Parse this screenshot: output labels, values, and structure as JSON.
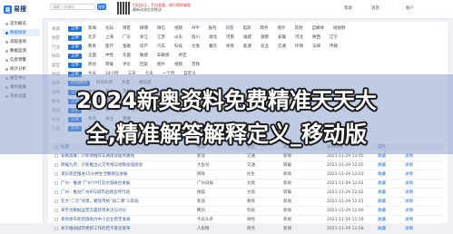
{
  "app": {
    "logo_text": "易搜",
    "logo_mark": "易"
  },
  "sidebar": {
    "items": [
      {
        "label": "首页概览",
        "active": false
      },
      {
        "label": "数据搜索",
        "active": true
      },
      {
        "label": "高级查询",
        "active": false
      },
      {
        "label": "数据监测",
        "active": false
      },
      {
        "label": "信息预警",
        "active": false
      },
      {
        "label": "统计分析",
        "active": false
      },
      {
        "label": "报告中心",
        "active": false
      },
      {
        "label": "素材收藏",
        "active": false
      },
      {
        "label": "系统设置",
        "active": false
      }
    ]
  },
  "topbar": {
    "search_placeholder": "请输入关键词",
    "search_button": "搜索",
    "advanced_button": "高级检索",
    "promo_line1": "扫码关注，手机查看，随时随地掌握",
    "promo_line2": "最新动态信息推送",
    "right_links": [
      "帮助",
      "消息",
      "账户"
    ]
  },
  "filters": [
    {
      "label": "来源",
      "tags": [
        "全部",
        "新闻",
        "论坛",
        "博客",
        "微博",
        "微信",
        "视频",
        "APP",
        "报刊",
        "问答",
        "电商",
        "政务",
        "境外",
        "其他",
        "自媒体",
        "短视频"
      ]
    },
    {
      "label": "地区",
      "tags": [
        "全部",
        "北京",
        "上海",
        "广东",
        "浙江",
        "江苏",
        "山东",
        "四川",
        "湖北",
        "河南",
        "福建",
        "湖南",
        "安徽",
        "河北",
        "陕西",
        "辽宁"
      ]
    },
    {
      "label": "行业",
      "tags": [
        "全部",
        "教育",
        "医疗",
        "金融",
        "房产",
        "汽车",
        "科技",
        "文旅",
        "餐饮",
        "体育",
        "能源",
        "农业",
        "交通",
        "环保",
        "法律",
        "传媒"
      ]
    },
    {
      "label": "倾向",
      "tags": [
        "全部",
        "正面",
        "中性",
        "负面",
        "敏感",
        "非敏感",
        "待定"
      ]
    },
    {
      "label": "类型",
      "tags": [
        "全部",
        "原创",
        "转载",
        "评论",
        "回复",
        "图片",
        "视频",
        "音频"
      ]
    },
    {
      "label": "时间",
      "tags": [
        "全部",
        "今天",
        "24小时",
        "三天",
        "七天",
        "一个月",
        "自定义"
      ]
    },
    {
      "label": "排序",
      "tags": [
        "时间降序",
        "时间升序",
        "热度",
        "相似度"
      ]
    },
    {
      "label": "语种",
      "tags": [
        "全部",
        "中文",
        "英文",
        "其他"
      ]
    },
    {
      "label": "媒体",
      "tags": [
        "全部",
        "央媒",
        "省媒",
        "地方",
        "商业"
      ]
    },
    {
      "label": "渠道",
      "tags": [
        "全部",
        "网页",
        "客户端",
        "小程序"
      ]
    },
    {
      "label": "标签",
      "tags": [
        "全部",
        "热点",
        "关注",
        "重要"
      ]
    },
    {
      "label": "已选",
      "tags": [
        "新闻",
        "全部地区"
      ]
    }
  ],
  "table": {
    "headers": [
      "标题",
      "来源",
      "标签",
      "类型",
      "发布时间",
      "操作",
      ""
    ],
    "rows": [
      {
        "title": "早晚高峰：沪新增推荐车辆接驳服务路线",
        "source": "新浪",
        "tag": "交通",
        "type": "新闻",
        "time": "2021-11-29 12:05",
        "op": "收藏",
        "op2": "详情"
      },
      {
        "title": "转载九月：沪新推出公交专线与地铁加强接驳",
        "source": "大鱼号",
        "tag": "交通",
        "type": "转载",
        "time": "2021-11-29 12:05",
        "op": "收藏",
        "op2": "详情"
      },
      {
        "title": "浦东新区推进15分钟生活圈建设进展",
        "source": "网易",
        "tag": "民生",
        "type": "新闻",
        "time": "2021-11-29 12:03",
        "op": "收藏",
        "op2": "详情"
      },
      {
        "title": "广州：推进“广州”IP打造文旅融合发展",
        "source": "广州日报",
        "tag": "文旅",
        "type": "新闻",
        "time": "2021-11-29 12:02",
        "op": "收藏",
        "op2": "详情"
      },
      {
        "title": "广州：推动广州IP与城市品牌宣传行动",
        "source": "搜狐",
        "tag": "文旅",
        "type": "转载",
        "time": "2021-11-29 12:02",
        "op": "收藏",
        "op2": "详情"
      },
      {
        "title": "在大“二元”背景，聚焦传统“加二课”三阶段",
        "source": "新浪",
        "tag": "教育",
        "type": "新闻",
        "time": "2021-11-29 12:01",
        "op": "收藏",
        "op2": "详情"
      },
      {
        "title": "某平台数据运营方面获得关注与讨论",
        "source": "腾讯",
        "tag": "科技",
        "type": "新闻",
        "time": "2021-11-29 12:00",
        "op": "收藏",
        "op2": "详情"
      },
      {
        "title": "某地发布新措施助力中小企业稳定发展",
        "source": "今日头条",
        "tag": "财经",
        "type": "新闻",
        "time": "2021-11-29 11:59",
        "op": "收藏",
        "op2": "详情"
      },
      {
        "title": "关于推动城市更新工作的若干意见发布",
        "source": "人民网",
        "tag": "政务",
        "type": "新闻",
        "time": "2021-11-29 11:58",
        "op": "收藏",
        "op2": "详情"
      }
    ]
  },
  "overlay": {
    "headline_line1": "2024新奥资料免费精准天天大",
    "headline_line2": "全,精准解答解释定义_移动版"
  }
}
